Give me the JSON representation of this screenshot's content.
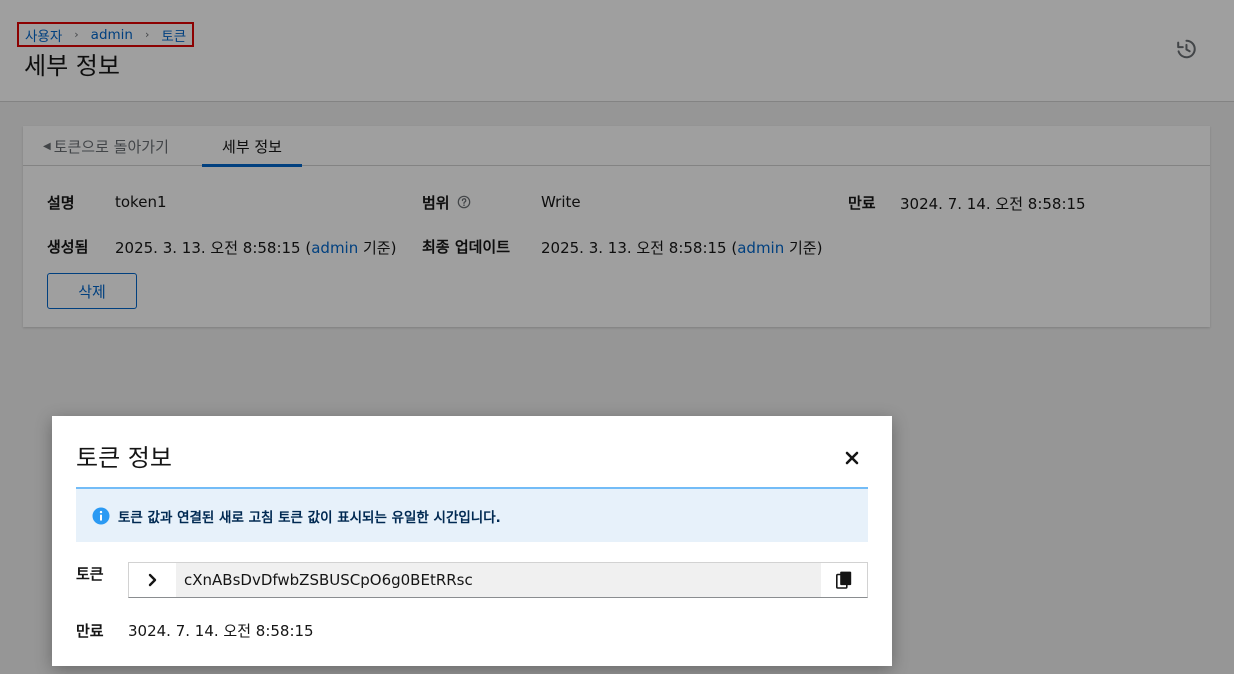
{
  "breadcrumb": {
    "items": [
      "사용자",
      "admin",
      "토큰"
    ],
    "separator": "›"
  },
  "page": {
    "title": "세부 정보"
  },
  "tabs": {
    "back_label": "토큰으로 돌아가기",
    "details_label": "세부 정보"
  },
  "details": {
    "description_label": "설명",
    "description_value": "token1",
    "scope_label": "범위",
    "scope_value": "Write",
    "expiry_label": "만료",
    "expiry_value": "3024. 7. 14. 오전 8:58:15",
    "created_label": "생성됨",
    "created_date": "2025. 3. 13. 오전 8:58:15 (",
    "created_by": "admin",
    "created_suffix": " 기준)",
    "updated_label": "최종 업데이트",
    "updated_date": "2025. 3. 13. 오전 8:58:15 (",
    "updated_by": "admin",
    "updated_suffix": " 기준)"
  },
  "actions": {
    "delete_label": "삭제"
  },
  "modal": {
    "title": "토큰 정보",
    "alert_text": "토큰 값과 연결된 새로 고침 토큰 값이 표시되는 유일한 시간입니다.",
    "token_label": "토큰",
    "token_value": "cXnABsDvDfwbZSBUSCpO6g0BEtRRsc",
    "expiry_label": "만료",
    "expiry_value": "3024. 7. 14. 오전 8:58:15"
  },
  "icons": {
    "history": "history-icon",
    "help": "help-icon",
    "close": "close-icon",
    "info": "info-icon",
    "expand": "chevron-right-icon",
    "copy": "copy-icon"
  },
  "colors": {
    "link": "#0066cc",
    "highlight_border": "#e00000",
    "alert_background": "#e7f1fa",
    "alert_border": "#73bcf7",
    "alert_icon": "#2b9af3"
  }
}
